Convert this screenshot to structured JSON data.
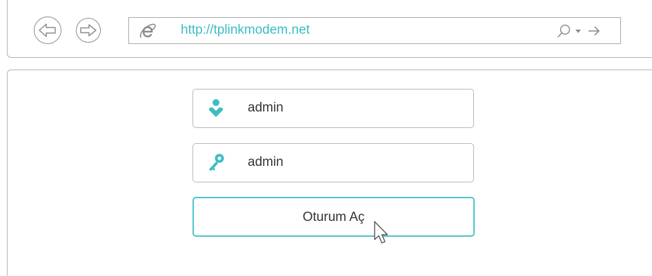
{
  "browser": {
    "url": "http://tplinkmodem.net"
  },
  "login": {
    "username_value": "admin",
    "password_value": "admin",
    "submit_label": "Oturum Aç"
  },
  "colors": {
    "accent": "#3cbcc6",
    "border": "#b3b3b3",
    "text": "#333333"
  },
  "icons": {
    "back": "back-arrow-icon",
    "forward": "forward-arrow-icon",
    "browser": "internet-explorer-icon",
    "search": "search-icon",
    "dropdown": "chevron-down-icon",
    "go": "go-arrow-icon",
    "user": "user-icon",
    "password": "key-icon",
    "cursor": "mouse-cursor-icon"
  }
}
